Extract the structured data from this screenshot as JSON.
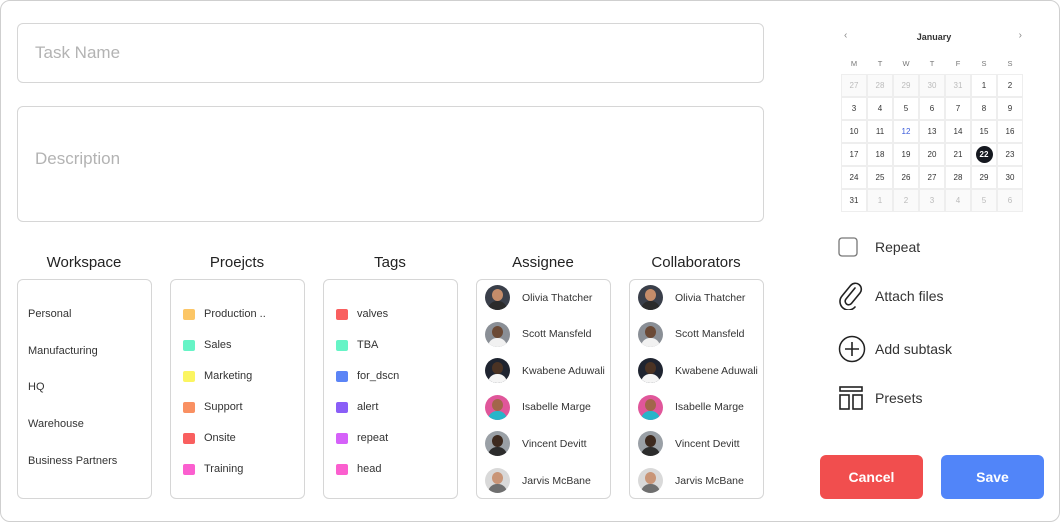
{
  "task_name": {
    "placeholder": "Task Name",
    "value": ""
  },
  "description": {
    "placeholder": "Description",
    "value": ""
  },
  "columns": {
    "workspace": {
      "title": "Workspace",
      "items": [
        "Personal",
        "Manufacturing",
        "HQ",
        "Warehouse",
        "Business Partners"
      ]
    },
    "projects": {
      "title": "Proejcts",
      "items": [
        {
          "label": "Production ..",
          "color": "#fcc666"
        },
        {
          "label": "Sales",
          "color": "#66f4c6"
        },
        {
          "label": "Marketing",
          "color": "#fbf561"
        },
        {
          "label": "Support",
          "color": "#f99062"
        },
        {
          "label": "Onsite",
          "color": "#f95f5f"
        },
        {
          "label": "Training",
          "color": "#fb5fcf"
        }
      ]
    },
    "tags": {
      "title": "Tags",
      "items": [
        {
          "label": "valves",
          "color": "#f95f5f"
        },
        {
          "label": "TBA",
          "color": "#66f4c6"
        },
        {
          "label": "for_dscn",
          "color": "#5b84f6"
        },
        {
          "label": "alert",
          "color": "#8a5ef7"
        },
        {
          "label": "repeat",
          "color": "#d561f9"
        },
        {
          "label": "head",
          "color": "#fb5fcf"
        }
      ]
    },
    "assignee": {
      "title": "Assignee",
      "people": [
        "Olivia Thatcher",
        "Scott Mansfeld",
        "Kwabene Aduwali",
        "Isabelle Marge",
        "Vincent Devitt",
        "Jarvis McBane"
      ]
    },
    "collaborators": {
      "title": "Collaborators",
      "people": [
        "Olivia Thatcher",
        "Scott Mansfeld",
        "Kwabene Aduwali",
        "Isabelle Marge",
        "Vincent Devitt",
        "Jarvis McBane"
      ]
    }
  },
  "avatar_colors": [
    {
      "bg": "#3a3f4a",
      "skin": "#c48c6a",
      "cloth": "#2b2b2b"
    },
    {
      "bg": "#8a8f96",
      "skin": "#6b4a36",
      "cloth": "#f1f1f1"
    },
    {
      "bg": "#1f2430",
      "skin": "#4b3324",
      "cloth": "#f5f5f5"
    },
    {
      "bg": "#e0569a",
      "skin": "#a2664a",
      "cloth": "#26b5c9"
    },
    {
      "bg": "#9aa0a6",
      "skin": "#3d2a1f",
      "cloth": "#2c2c2c"
    },
    {
      "bg": "#d9d9d9",
      "skin": "#c99577",
      "cloth": "#6f6f6f"
    }
  ],
  "calendar": {
    "month": "January",
    "prev_icon": "‹",
    "next_icon": "›",
    "weekdays": [
      "M",
      "T",
      "W",
      "T",
      "F",
      "S",
      "S"
    ],
    "weeks": [
      [
        "27",
        "28",
        "29",
        "30",
        "31",
        "1",
        "2"
      ],
      [
        "3",
        "4",
        "5",
        "6",
        "7",
        "8",
        "9"
      ],
      [
        "10",
        "11",
        "12",
        "13",
        "14",
        "15",
        "16"
      ],
      [
        "17",
        "18",
        "19",
        "20",
        "21",
        "22",
        "23"
      ],
      [
        "24",
        "25",
        "26",
        "27",
        "28",
        "29",
        "30"
      ],
      [
        "31",
        "1",
        "2",
        "3",
        "4",
        "5",
        "6"
      ]
    ],
    "today": "12",
    "selected": "22"
  },
  "actions": {
    "repeat": "Repeat",
    "attach": "Attach files",
    "subtask": "Add subtask",
    "presets": "Presets"
  },
  "buttons": {
    "cancel": "Cancel",
    "save": "Save"
  }
}
